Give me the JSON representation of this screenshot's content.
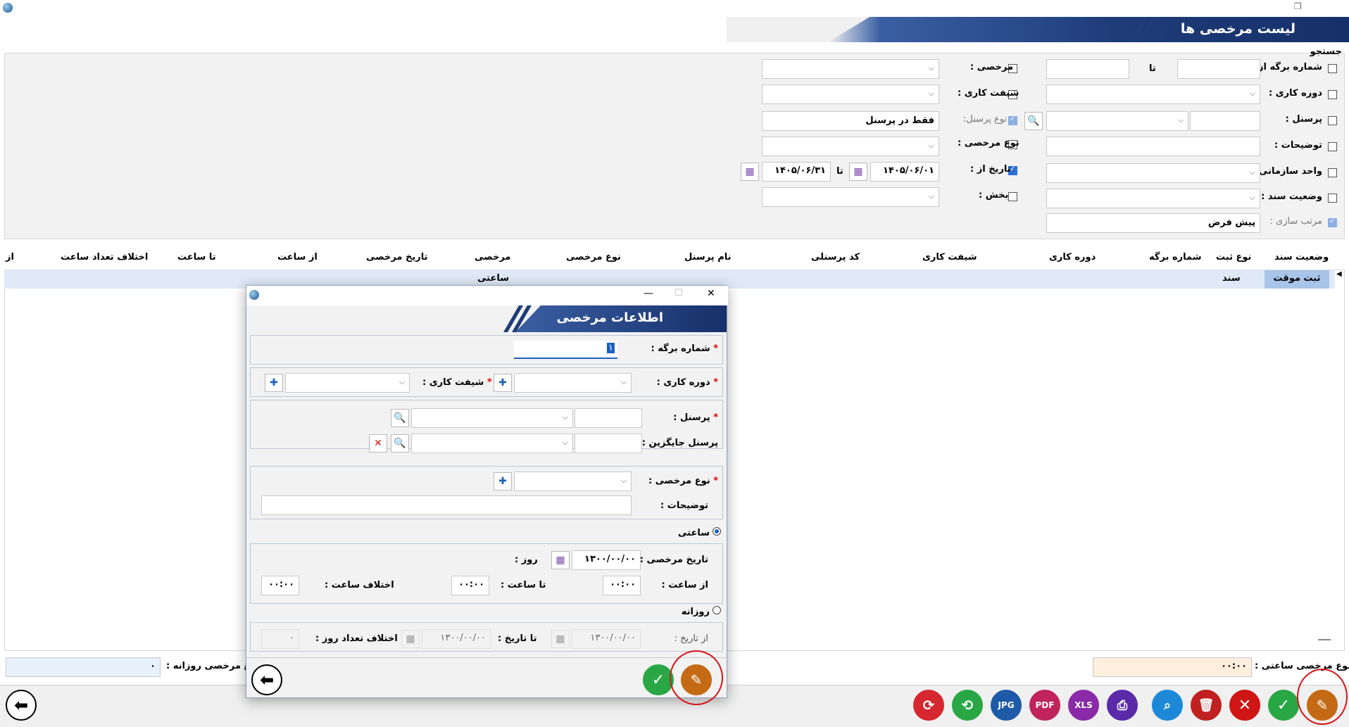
{
  "window": {
    "title": "لیست مرخصی ها"
  },
  "search": {
    "label": "جستجو",
    "sheet_from": "شماره برگه از :",
    "to": "تا",
    "work_period": "دوره کاری :",
    "personnel": "پرسنل :",
    "description": "توضیحات :",
    "org_unit": "واحد سازمانی :",
    "doc_status": "وضعیت سند :",
    "sort": "مرتب سازی :",
    "sort_value": "پیش فرض",
    "leave": "مرخصی :",
    "shift": "شیفت کاری :",
    "personnel_type": "نوع پرسنل:",
    "personnel_type_value": "فقط در پرسنل",
    "leave_type": "نوع مرخصی :",
    "date_from": "تاریخ از :",
    "date_from_value": "۱۴۰۵/۰۶/۰۱",
    "date_to_label": "تا",
    "date_to_value": "۱۴۰۵/۰۶/۳۱",
    "section": "بخش :"
  },
  "table": {
    "headers": [
      "وضعیت سند",
      "نوع ثبت",
      "شماره برگه",
      "دوره کاری",
      "شیفت کاری",
      "کد پرسنلی",
      "نام پرسنل",
      "نوع مرخصی",
      "مرخصی",
      "تاریخ مرخصی",
      "از ساعت",
      "تا ساعت",
      "اختلاف تعداد ساعت",
      "از"
    ],
    "row": {
      "status": "ثبت موقت",
      "reg_type": "سند",
      "leave": "ساعتی"
    }
  },
  "footer": {
    "hourly_total_label": "مجموع مرخصی ساعتی :",
    "hourly_total_value": "۰۰:۰۰",
    "daily_total_label": "جمع مرخصی روزانه :",
    "daily_total_value": "۰"
  },
  "toolbar": {
    "labels": {
      "jpg": "JPG",
      "pdf": "PDF",
      "xls": "XLS"
    },
    "colors": {
      "refresh": "#d6262f",
      "sync": "#29a745",
      "jpg": "#1e5aa8",
      "pdf": "#c0245a",
      "xls": "#8a2aa8",
      "print": "#5a2aa8",
      "search": "#1e88d8",
      "delete": "#c0201f",
      "cancel": "#d01515",
      "confirm": "#29a745",
      "edit": "#c46a14"
    }
  },
  "dialog": {
    "title": "اطلاعات مرخصی",
    "sheet_no_label": "شماره برگه :",
    "sheet_no_value": "۱",
    "work_period_label": "دوره کاری :",
    "shift_label": "شیفت کاری :",
    "personnel_label": "پرسنل :",
    "substitute_label": "پرسنل جایگزین :",
    "leave_type_label": "نوع مرخصی :",
    "description_label": "توضیحات :",
    "hourly_label": "ساعتی",
    "leave_date_label": "تاریخ مرخصی :",
    "leave_date_value": "۱۳۰۰/۰۰/۰۰",
    "day_label": "روز :",
    "from_hour_label": "از ساعت :",
    "from_hour_value": "۰۰:۰۰",
    "to_hour_label": "تا ساعت :",
    "to_hour_value": "۰۰:۰۰",
    "hour_diff_label": "اختلاف ساعت :",
    "hour_diff_value": "۰۰:۰۰",
    "daily_label": "روزانه",
    "from_date_label": "از تاریخ :",
    "from_date_value": "۱۳۰۰/۰۰/۰۰",
    "to_date_label": "تا تاریخ :",
    "to_date_value": "۱۳۰۰/۰۰/۰۰",
    "day_diff_label": "اختلاف تعداد روز :",
    "day_diff_value": "۰"
  }
}
